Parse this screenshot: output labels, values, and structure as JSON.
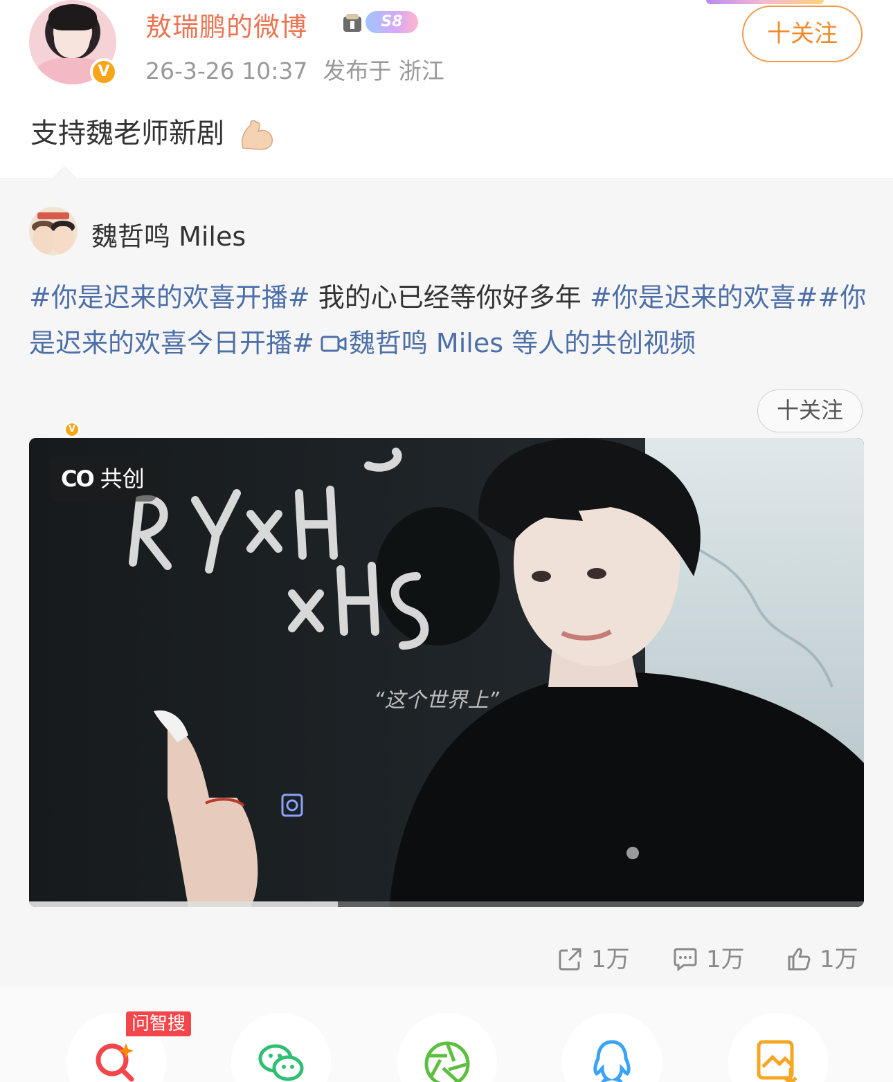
{
  "author": {
    "name": "敖瑞鹏的微博",
    "level_badge": "S8",
    "verified_badge": "V",
    "timestamp": "26-3-26 10:37",
    "location": "发布于 浙江",
    "follow_label": "十关注"
  },
  "post": {
    "text": "支持魏老师新剧"
  },
  "repost": {
    "author_name": "魏哲鸣 Miles",
    "verified_badge": "V",
    "follow_label": "十关注",
    "text_parts": {
      "tag1": "#你是迟来的欢喜开播#",
      "plain": " 我的心已经等你好多年 ",
      "tag2": "#你是迟来的欢喜#",
      "tag3": "#你是迟来的欢喜今日开播#",
      "video_link": "魏哲鸣 Miles 等人的共创视频"
    },
    "video": {
      "badge_icon": "CO",
      "badge_label": "共创",
      "overlay_text": "RYxH",
      "overlay_text2": "xHS",
      "subtitle": "“这个世界上”",
      "progress": 0.37
    },
    "stats": {
      "reposts": "1万",
      "comments": "1万",
      "likes": "1万"
    }
  },
  "share_sheet": {
    "ai_tag": "问智搜",
    "items": [
      "search-icon",
      "wechat-icon",
      "moments-icon",
      "qq-icon",
      "save-image-icon"
    ]
  },
  "colors": {
    "username": "#eb7350",
    "link": "#4d6fa8",
    "follow": "#f08a2d"
  }
}
